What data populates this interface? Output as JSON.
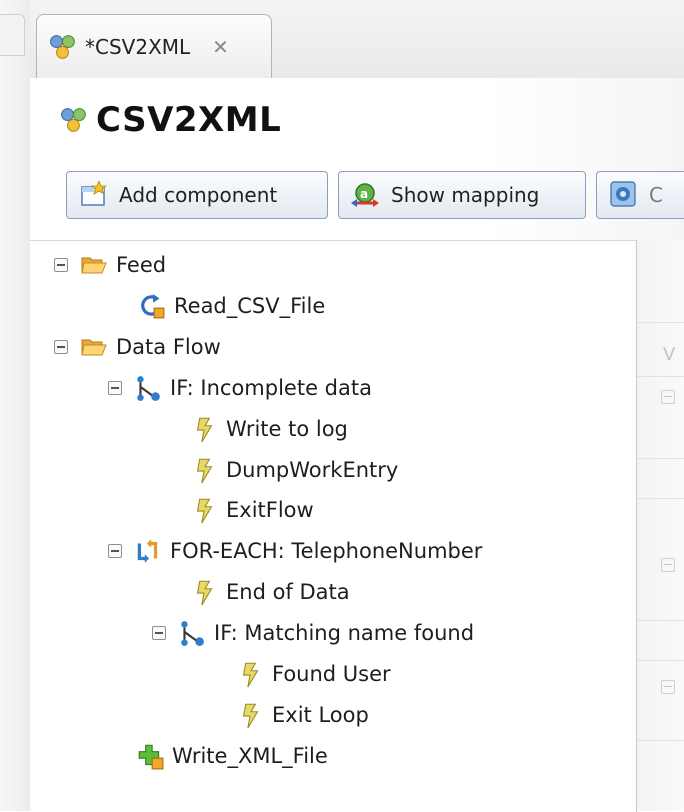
{
  "tab": {
    "label": "*CSV2XML",
    "icon": "component-cluster-icon",
    "close_icon": "close-icon"
  },
  "header": {
    "title": "CSV2XML",
    "icon": "component-cluster-icon"
  },
  "toolbar": {
    "add_component_label": "Add component",
    "show_mapping_label": "Show mapping",
    "third_label": "C"
  },
  "tree": {
    "nodes": [
      {
        "label": "Feed",
        "icon": "folder-open-icon",
        "expanded": true
      },
      {
        "label": "Read_CSV_File",
        "icon": "read-refresh-icon"
      },
      {
        "label": "Data Flow",
        "icon": "folder-open-icon",
        "expanded": true
      },
      {
        "label": "IF: Incomplete data",
        "icon": "branch-if-icon",
        "expanded": true
      },
      {
        "label": "Write to log",
        "icon": "action-bolt-icon"
      },
      {
        "label": "DumpWorkEntry",
        "icon": "action-bolt-icon"
      },
      {
        "label": "ExitFlow",
        "icon": "action-bolt-icon"
      },
      {
        "label": "FOR-EACH: TelephoneNumber",
        "icon": "loop-foreach-icon",
        "expanded": true
      },
      {
        "label": "End of Data",
        "icon": "action-bolt-icon"
      },
      {
        "label": "IF: Matching name found",
        "icon": "branch-if-icon",
        "expanded": true
      },
      {
        "label": "Found User",
        "icon": "action-bolt-icon"
      },
      {
        "label": "Exit Loop",
        "icon": "action-bolt-icon"
      },
      {
        "label": "Write_XML_File",
        "icon": "write-plus-icon"
      }
    ]
  },
  "right_panel": {
    "fragment_text": "V"
  },
  "colors": {
    "button_border": "#8aa0bd",
    "folder": "#f0b840",
    "bolt": "#e2d35a"
  }
}
